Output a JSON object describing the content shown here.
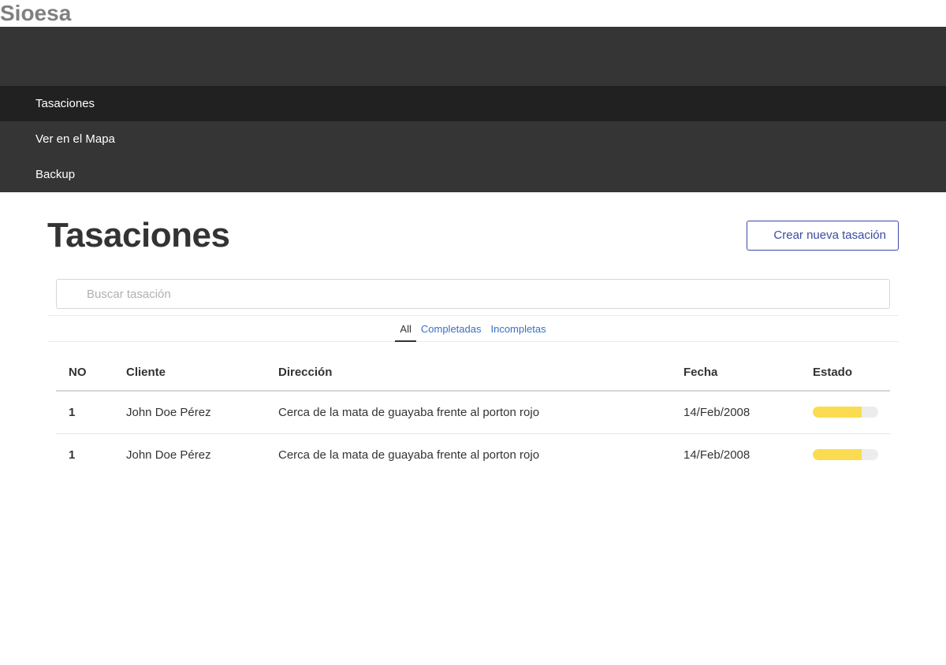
{
  "app": {
    "brand": "Sioesa"
  },
  "nav": {
    "items": [
      {
        "label": "Tasaciones",
        "active": true
      },
      {
        "label": "Ver en el Mapa",
        "active": false
      },
      {
        "label": "Backup",
        "active": false
      }
    ]
  },
  "page": {
    "title": "Tasaciones",
    "create_button_label": "Crear nueva tasación"
  },
  "search": {
    "placeholder": "Buscar tasación",
    "value": ""
  },
  "filters": {
    "tabs": [
      {
        "label": "All",
        "active": true
      },
      {
        "label": "Completadas",
        "active": false
      },
      {
        "label": "Incompletas",
        "active": false
      }
    ]
  },
  "table": {
    "headers": {
      "no": "NO",
      "cliente": "Cliente",
      "direccion": "Dirección",
      "fecha": "Fecha",
      "estado": "Estado"
    },
    "rows": [
      {
        "no": "1",
        "cliente": "John Doe Pérez",
        "direccion": "Cerca de la mata de guayaba frente al porton rojo",
        "fecha": "14/Feb/2008",
        "progress": 0.75
      },
      {
        "no": "1",
        "cliente": "John Doe Pérez",
        "direccion": "Cerca de la mata de guayaba frente al porton rojo",
        "fecha": "14/Feb/2008",
        "progress": 0.75
      }
    ]
  },
  "colors": {
    "navbar": "#353535",
    "nav_active": "#212121",
    "accent": "#3b4aa0",
    "link": "#3a6fc4",
    "progress_fill": "#fbdc50",
    "progress_track": "#ececec"
  },
  "icons": {
    "search": "search-icon"
  }
}
